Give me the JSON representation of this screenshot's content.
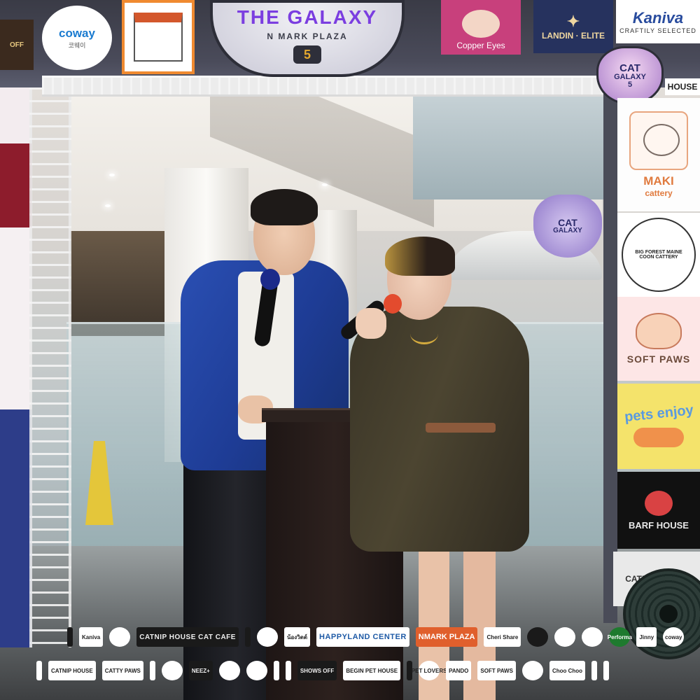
{
  "top_banner": {
    "left_logo": "OFF",
    "coway": {
      "name": "coway",
      "korean": "코웨이"
    },
    "galaxy": {
      "title": "THE GALAXY",
      "subtitle": "N MARK PLAZA",
      "number": "5"
    },
    "copper_eyes": "Copper Eyes",
    "landin": "LANDIN · ELITE",
    "kaniva": {
      "name": "Kaniva",
      "tagline": "CRAFTILY SELECTED"
    },
    "cat_galaxy_badge": {
      "line1": "CAT",
      "line2": "GALAXY",
      "number": "5"
    },
    "house_label": "HOUSE"
  },
  "background_badge": {
    "line1": "CAT",
    "line2": "GALAXY"
  },
  "right_boards": {
    "maki": {
      "name": "MAKI",
      "sub": "cattery"
    },
    "bigforest": "BIG FOREST MAINE COON CATTERY",
    "softpaws": "SOFT PAWS",
    "pets_enjoy": "pets enjoy",
    "barf_house": "BARF HOUSE",
    "catnip_house": "CATNIP HOUSE"
  },
  "sponsors_row1": [
    "",
    "Kaniva",
    "",
    "CATNIP HOUSE CAT CAFE",
    "",
    "",
    "น้องวิตต์",
    "HAPPYLAND CENTER",
    "NMARK PLAZA",
    "Cheri Share",
    "",
    "",
    "",
    "Performa",
    "Jinny",
    "coway"
  ],
  "sponsors_row2": [
    "",
    "CATNIP HOUSE",
    "CATTY PAWS",
    "",
    "",
    "NEEZ+",
    "",
    "",
    "",
    "",
    "SHOWS OFF",
    "BEGIN PET HOUSE",
    "",
    "PET LOVERS",
    "PANDO",
    "SOFT PAWS",
    "",
    "Choo Choo",
    "",
    ""
  ],
  "colors": {
    "jacket": "#1e3c95",
    "dress": "#4c4531",
    "mic_left": "#1b2a8a",
    "mic_right": "#e34b2e"
  }
}
